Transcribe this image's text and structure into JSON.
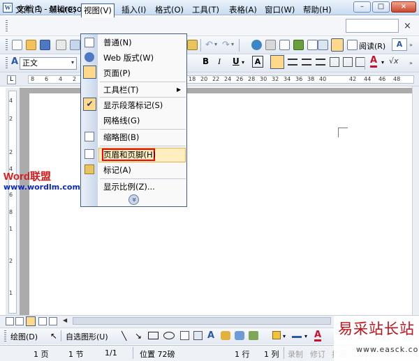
{
  "window": {
    "title": "文档 1 - Microsoft Word",
    "app_icon_letter": "W",
    "min": "–",
    "max": "□",
    "close": "×"
  },
  "menubar": {
    "items": [
      "文件(F)",
      "编辑(E)",
      "视图(V)",
      "插入(I)",
      "格式(O)",
      "工具(T)",
      "表格(A)",
      "窗口(W)",
      "帮助(H)"
    ],
    "close_glyph": "×"
  },
  "toolbar1": {
    "reading_label": "阅读(R)",
    "zoom_icon": "A"
  },
  "toolbar2": {
    "style_value": "正文",
    "style_icon": "A",
    "bold": "B",
    "italic": "I",
    "underline": "U",
    "charbox": "A",
    "font_color": "A",
    "extra": "√x"
  },
  "ruler": {
    "tab_selector": "L",
    "numbers": [
      "8",
      "6",
      "4",
      "2",
      "18",
      "20",
      "22",
      "24",
      "26",
      "28",
      "30",
      "32",
      "34",
      "36",
      "38",
      "40",
      "42",
      "44",
      "46",
      "48"
    ],
    "vnumbers": [
      "4",
      "2",
      "2",
      "4",
      "6",
      "8",
      "1",
      "2",
      "1"
    ]
  },
  "view_menu": {
    "items": [
      {
        "label": "普通(N)"
      },
      {
        "label": "Web 版式(W)"
      },
      {
        "label": "页面(P)"
      },
      {
        "label": "工具栏(T)",
        "submenu": true
      },
      {
        "label": "显示段落标记(S)",
        "checked": true
      },
      {
        "label": "网格线(G)"
      },
      {
        "label": "缩略图(B)"
      },
      {
        "label": "页眉和页脚(H)",
        "highlighted": true
      },
      {
        "label": "标记(A)"
      },
      {
        "label": "显示比例(Z)..."
      }
    ],
    "submenu_arrow": "▶",
    "check_glyph": "✔",
    "expand_glyph": "»"
  },
  "logo": {
    "text": "Word联盟",
    "url": "www.wordlm.com"
  },
  "drawbar": {
    "draw_label": "绘图(D)",
    "autoshape_label": "自选图形(U)"
  },
  "statusbar": {
    "page": "1 页",
    "section": "1 节",
    "page_of": "1/1",
    "position": "位置 72磅",
    "line": "1 行",
    "col": "1 列",
    "rec": "录制",
    "trk": "修订",
    "ext": "扩展",
    "ovr": "改写"
  },
  "watermark": {
    "cn": "易采站长站",
    "url": "www.easck.com"
  },
  "colors": {
    "menu_border": "#3e5d88",
    "highlight": "#ffefc0",
    "red_outline": "#ff0000"
  }
}
